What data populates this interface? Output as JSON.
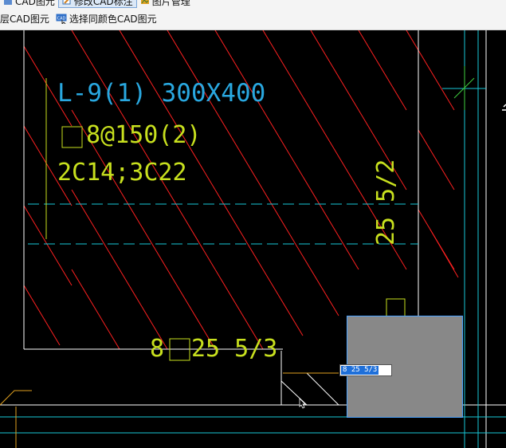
{
  "toolbar": {
    "row1": [
      {
        "label": "CAD图元",
        "icon": "cad-element-icon",
        "active": false
      },
      {
        "label": "修改CAD标注",
        "icon": "edit-annotation-icon",
        "active": true
      },
      {
        "label": "图片管理",
        "icon": "image-manage-icon",
        "active": false
      }
    ],
    "row2": [
      {
        "label": "层CAD图元",
        "icon": "layer-cad-icon",
        "active": false
      },
      {
        "label": "选择同颜色CAD图元",
        "icon": "cad-select-color-icon",
        "active": false
      }
    ]
  },
  "drawing": {
    "beam_label": "L-9(1) 300X400",
    "stirrup_prefix": "",
    "stirrup_label": "8@150(2)",
    "rebar_label": "2C14;3C22",
    "bottom_prefix": "8",
    "bottom_label": "25 5/3",
    "vertical_label": "25 5/2",
    "edit_value": "8 25 5/3"
  },
  "colors": {
    "beam_text": "#29a8e0",
    "rebar_text": "#c8e01e",
    "hatch": "#ff2020",
    "outline": "#ffffff",
    "cyan_line": "#18c8d8",
    "green_line": "#40d040",
    "selection": "#888888",
    "selection_border": "#4da3ff"
  }
}
